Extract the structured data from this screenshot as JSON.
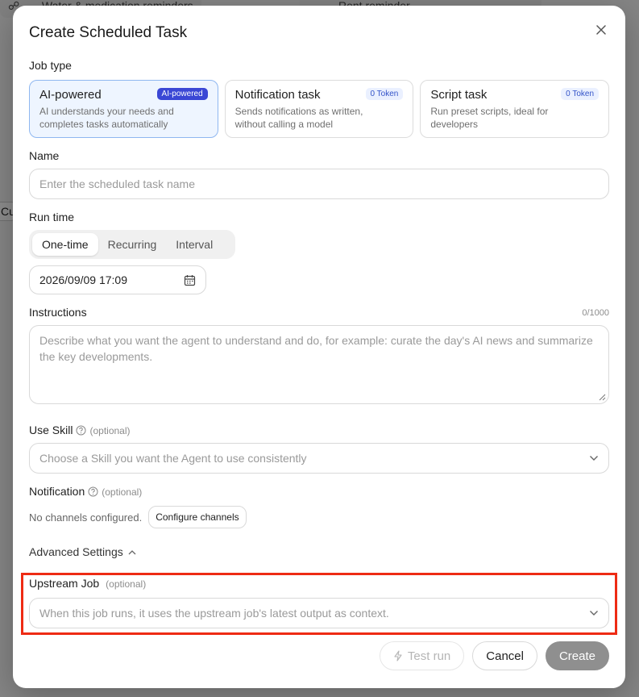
{
  "background": {
    "pill_left": "Water & medication reminders",
    "pill_right": "Rent reminder",
    "left_fragment": "Cur"
  },
  "modal": {
    "title": "Create Scheduled Task",
    "job_type": {
      "label": "Job type",
      "options": [
        {
          "title": "AI-powered",
          "badge": "AI-powered",
          "desc": "AI understands your needs and completes tasks automatically",
          "selected": true
        },
        {
          "title": "Notification task",
          "badge": "0 Token",
          "desc": "Sends notifications as written, without calling a model",
          "selected": false
        },
        {
          "title": "Script task",
          "badge": "0 Token",
          "desc": "Run preset scripts, ideal for developers",
          "selected": false
        }
      ]
    },
    "name": {
      "label": "Name",
      "placeholder": "Enter the scheduled task name"
    },
    "run_time": {
      "label": "Run time",
      "modes": [
        "One-time",
        "Recurring",
        "Interval"
      ],
      "selected_mode": "One-time",
      "datetime": "2026/09/09 17:09"
    },
    "instructions": {
      "label": "Instructions",
      "counter": "0/1000",
      "placeholder": "Describe what you want the agent to understand and do, for example: curate the day's AI news and summarize the key developments."
    },
    "use_skill": {
      "label": "Use Skill",
      "optional": "(optional)",
      "placeholder": "Choose a Skill you want the Agent to use consistently"
    },
    "notification": {
      "label": "Notification",
      "optional": "(optional)",
      "status": "No channels configured.",
      "configure_label": "Configure channels"
    },
    "advanced": {
      "label": "Advanced Settings"
    },
    "upstream_job": {
      "label": "Upstream Job",
      "optional": "(optional)",
      "placeholder": "When this job runs, it uses the upstream job's latest output as context."
    },
    "footer": {
      "test_run": "Test run",
      "cancel": "Cancel",
      "create": "Create"
    }
  },
  "colors": {
    "accent": "#3a47d5",
    "highlight": "#ee2b14",
    "selected_card_bg": "#eef5ff",
    "primary_disabled": "#8f8f8f"
  },
  "icons": [
    "close-icon",
    "calendar-icon",
    "help-icon",
    "chevron-down-icon",
    "chevron-up-icon",
    "bolt-icon"
  ]
}
